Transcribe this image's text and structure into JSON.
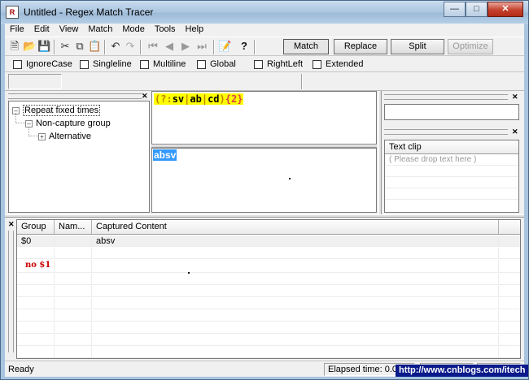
{
  "window": {
    "title": "Untitled - Regex Match Tracer"
  },
  "menu": [
    "File",
    "Edit",
    "View",
    "Match",
    "Mode",
    "Tools",
    "Help"
  ],
  "toolbar": {
    "icons": [
      "new-file-icon",
      "open-folder-icon",
      "save-icon",
      "cut-icon",
      "copy-icon",
      "paste-icon",
      "undo-icon",
      "redo-icon",
      "first-icon",
      "prev-icon",
      "next-icon",
      "last-icon",
      "insert-icon",
      "help-icon"
    ],
    "match_label": "Match",
    "replace_label": "Replace",
    "split_label": "Split",
    "optimize_label": "Optimize"
  },
  "options": [
    "IgnoreCase",
    "Singleline",
    "Multiline",
    "Global",
    "RightLeft",
    "Extended"
  ],
  "tree": {
    "root": "Repeat fixed times",
    "child": "Non-capture group",
    "grandchild": "Alternative"
  },
  "regex": {
    "open": "(?:",
    "alt1": "sv",
    "bar1": "|",
    "alt2": "ab",
    "bar2": "|",
    "alt3": "cd",
    "close": ")",
    "quant": "{2}"
  },
  "text": {
    "content": "absv"
  },
  "clip": {
    "header": "Text clip",
    "placeholder": "( Please drop text here )"
  },
  "results": {
    "columns": [
      "Group",
      "Nam...",
      "Captured Content"
    ],
    "rows": [
      {
        "group": "$0",
        "name": "",
        "content": "absv"
      },
      {
        "group": "no $1",
        "name": "",
        "content": ""
      }
    ]
  },
  "status": {
    "text": "Ready",
    "elapsed": "Elapsed time: 0.00",
    "watermark": "http://www.cnblogs.com/itech"
  }
}
